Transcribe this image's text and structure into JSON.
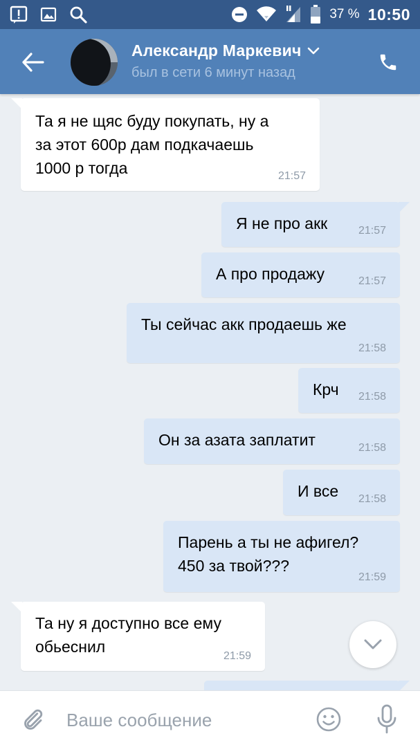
{
  "status_bar": {
    "battery_percent": "37 %",
    "time": "10:50",
    "icons": [
      "notification-alert-icon",
      "gallery-icon",
      "search-icon",
      "do-not-disturb-icon",
      "wifi-icon",
      "signal-icon",
      "battery-icon"
    ]
  },
  "header": {
    "contact_name": "Александр Маркевич",
    "status": "был в сети 6 минут назад"
  },
  "messages": [
    {
      "direction": "in",
      "text": "Та я не щяс буду покупать, ну а\nза этот 600р дам подкачаешь\n1000 р тогда",
      "time": "21:57"
    },
    {
      "direction": "out",
      "text": "Я не про акк",
      "time": "21:57"
    },
    {
      "direction": "out",
      "text": "А про продажу",
      "time": "21:57"
    },
    {
      "direction": "out",
      "text": "Ты сейчас акк продаешь же",
      "time": "21:58"
    },
    {
      "direction": "out",
      "text": "Крч",
      "time": "21:58"
    },
    {
      "direction": "out",
      "text": "Он за азата заплатит",
      "time": "21:58"
    },
    {
      "direction": "out",
      "text": "И все",
      "time": "21:58"
    },
    {
      "direction": "out",
      "text": "Парень а ты не афигел?\n450 за твой???",
      "time": "21:59"
    },
    {
      "direction": "in",
      "text": "Та ну я доступно все ему\nобьеснил",
      "time": "21:59"
    }
  ],
  "input": {
    "placeholder": "Ваше сообщение",
    "value": ""
  },
  "colors": {
    "status_bar": "#34598a",
    "header": "#5181b8",
    "chat_background": "#ebeff3",
    "incoming_bubble": "#ffffff",
    "outgoing_bubble": "#d9e6f6",
    "icon_gray": "#99a2ad"
  }
}
